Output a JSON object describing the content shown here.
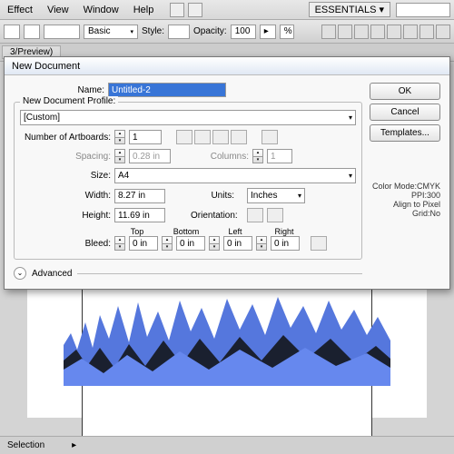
{
  "menu": {
    "items": [
      "Effect",
      "View",
      "Window",
      "Help"
    ]
  },
  "workspace": {
    "label": "ESSENTIALS ▾"
  },
  "toolbar": {
    "basic": "Basic",
    "style": "Style:",
    "opacity": "Opacity:",
    "opval": "100"
  },
  "tab": {
    "label": "3/Preview)"
  },
  "dialog": {
    "title": "New Document",
    "name_label": "Name:",
    "name_value": "Untitled-2",
    "profile_label": "New Document Profile:",
    "profile_value": "[Custom]",
    "artboards_label": "Number of Artboards:",
    "artboards_value": "1",
    "spacing_label": "Spacing:",
    "spacing_value": "0.28 in",
    "columns_label": "Columns:",
    "columns_value": "1",
    "size_label": "Size:",
    "size_value": "A4",
    "width_label": "Width:",
    "width_value": "8.27 in",
    "units_label": "Units:",
    "units_value": "Inches",
    "height_label": "Height:",
    "height_value": "11.69 in",
    "orient_label": "Orientation:",
    "bleed_label": "Bleed:",
    "top": "Top",
    "bottom": "Bottom",
    "left": "Left",
    "right": "Right",
    "bleed_val": "0 in",
    "advanced": "Advanced",
    "ok": "OK",
    "cancel": "Cancel",
    "templates": "Templates...",
    "info1": "Color Mode:CMYK",
    "info2": "PPI:300",
    "info3": "Align to Pixel Grid:No"
  },
  "status": {
    "left": "Selection",
    "arrow": "▸"
  }
}
